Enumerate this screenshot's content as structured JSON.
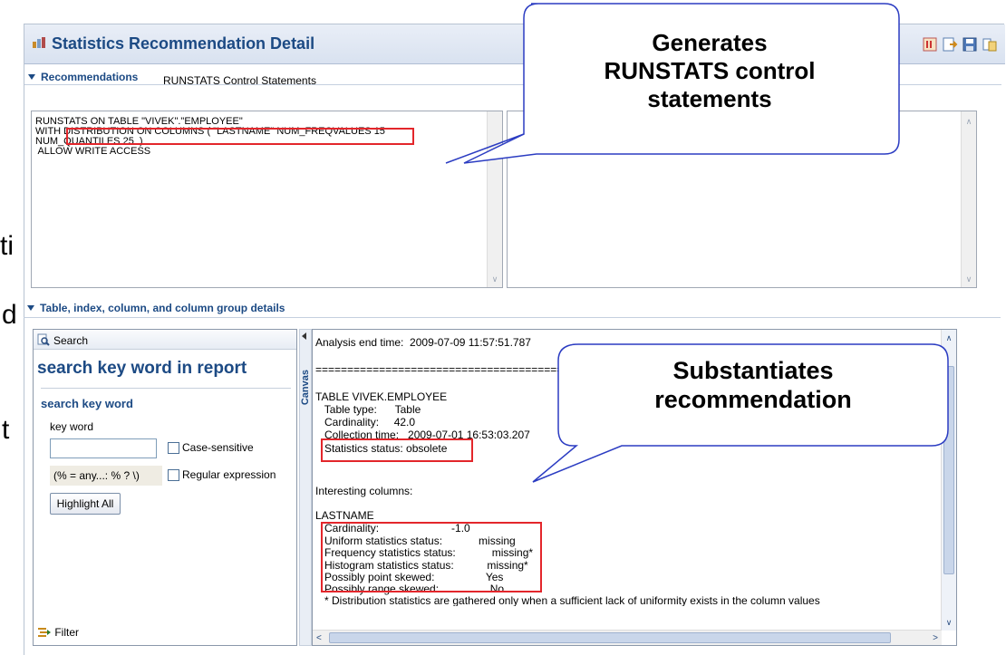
{
  "slide_fragments": [
    "ti",
    "d",
    "t"
  ],
  "window": {
    "title": "Statistics Recommendation Detail"
  },
  "sections": {
    "recommendations": "Recommendations",
    "details": "Table, index, column, and column group details"
  },
  "runstats": {
    "label": "RUNSTATS Control Statements",
    "lines": [
      "RUNSTATS ON TABLE \"VIVEK\".\"EMPLOYEE\"",
      "WITH DISTRIBUTION ON COLUMNS ( \"LASTNAME\" NUM_FREQVALUES 15",
      "NUM_QUANTILES 25  )",
      " ALLOW WRITE ACCESS"
    ]
  },
  "search_panel": {
    "header": "Search",
    "title": "search key word in report",
    "group_title": "search key word",
    "key_word_label": "key word",
    "key_word_value": "",
    "case_sensitive_label": "Case-sensitive",
    "regex_hint": "(% = any...: % ? \\)",
    "regex_label": "Regular expression",
    "highlight_button": "Highlight All",
    "filter_label": "Filter"
  },
  "canvas_tab": "Canvas",
  "report": {
    "lines": [
      "Analysis end time:  2009-07-09 11:57:51.787",
      "===================================================================================================",
      "TABLE VIVEK.EMPLOYEE",
      "   Table type:      Table",
      "   Cardinality:     42.0",
      "   Collection time:   2009-07-01 16:53:03.207",
      "   Statistics status: obsolete",
      "Interesting columns:",
      "LASTNAME",
      "   Cardinality:                        -1.0",
      "   Uniform statistics status:            missing",
      "   Frequency statistics status:            missing*",
      "   Histogram statistics status:           missing*",
      "   Possibly point skewed:                 Yes",
      "   Possibly range skewed:                 No",
      "   * Distribution statistics are gathered only when a sufficient lack of uniformity exists in the column values"
    ]
  },
  "callouts": {
    "top": [
      "Generates",
      "RUNSTATS control",
      "statements"
    ],
    "bottom": [
      "Substantiates",
      "recommendation"
    ]
  }
}
